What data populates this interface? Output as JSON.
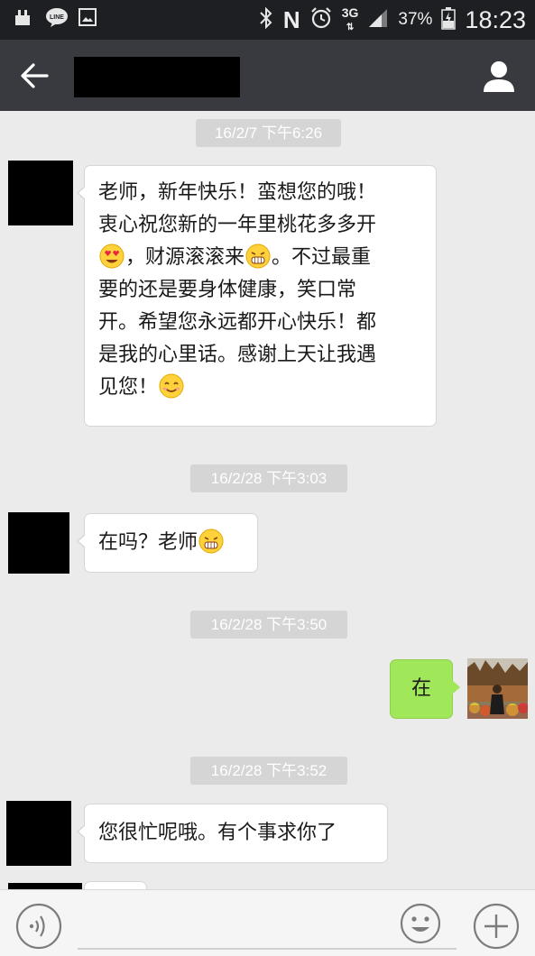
{
  "status_bar": {
    "icons": [
      "usb-icon",
      "line-icon",
      "gallery-icon",
      "bluetooth-icon",
      "nfc-icon",
      "alarm-icon",
      "signal-icon",
      "battery-icon"
    ],
    "nfc_label": "N",
    "network": "3G",
    "battery": "37%",
    "time": "18:23"
  },
  "header": {
    "back_icon": "arrow-left-icon",
    "profile_icon": "person-icon"
  },
  "messages": {
    "ts1": "16/2/7 下午6:26",
    "m1_l1": "老师，新年快乐！蛮想您的哦！",
    "m1_l2": "衷心祝您新的一年里桃花多多开",
    "m1_l3a": "，财源滚滚来",
    "m1_l3b": "。不过最重",
    "m1_l4": "要的还是要身体健康，笑口常",
    "m1_l5": "开。希望您永远都开心快乐！都",
    "m1_l6": "是我的心里话。感谢上天让我遇",
    "m1_l7": "见您！",
    "ts2": "16/2/28 下午3:03",
    "m2": "在吗？老师",
    "ts3": "16/2/28 下午3:50",
    "m3": "在",
    "ts4": "16/2/28 下午3:52",
    "m4": "您很忙呢哦。有个事求你了"
  },
  "colors": {
    "status_bar": "#1e1f23",
    "header": "#393a3f",
    "chat_bg": "#ebebeb",
    "sent_bubble": "#a0e75a",
    "received_bubble": "#ffffff",
    "timestamp_bg": "#d5d5d5"
  },
  "bottom_bar": {
    "voice_icon": "voice-icon",
    "emoji_icon": "emoji-icon",
    "plus_icon": "plus-icon"
  }
}
